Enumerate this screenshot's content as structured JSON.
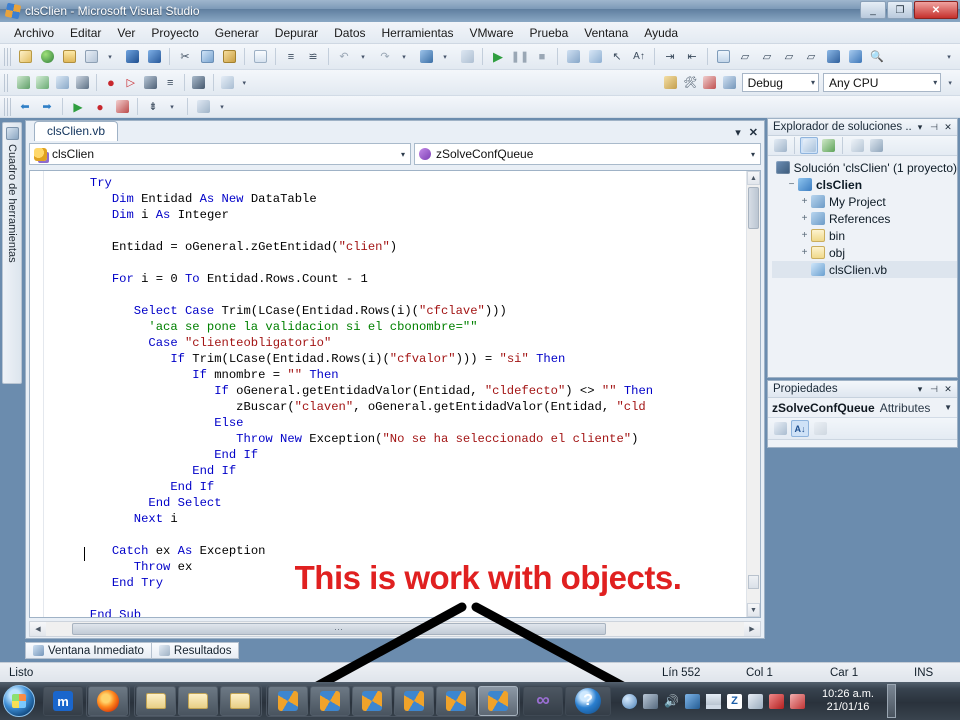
{
  "window": {
    "title": "clsClien - Microsoft Visual Studio",
    "icon": "visual-studio-icon",
    "minimize": "_",
    "maximize": "❐",
    "close": "✕"
  },
  "menubar": {
    "items": [
      "Archivo",
      "Editar",
      "Ver",
      "Proyecto",
      "Generar",
      "Depurar",
      "Datos",
      "Herramientas",
      "VMware",
      "Prueba",
      "Ventana",
      "Ayuda"
    ]
  },
  "toolbar": {
    "configuration": "Debug",
    "platform": "Any CPU",
    "overflow_label": "▾"
  },
  "left_dock": {
    "toolbox_label": "Cuadro de herramientas",
    "toolbox_icon": "toolbox-icon"
  },
  "editor": {
    "tab_label": "clsClien.vb",
    "tab_menu_icon": "▾",
    "tab_close_icon": "✕",
    "class_combo": "clsClien",
    "member_combo": "zSolveConfQueue",
    "dropdown_arrow": "▼",
    "code_lines": [
      {
        "indent": 6,
        "spans": [
          {
            "t": "Try",
            "c": "kw"
          }
        ]
      },
      {
        "indent": 9,
        "spans": [
          {
            "t": "Dim ",
            "c": "kw"
          },
          {
            "t": "Entidad ",
            "c": ""
          },
          {
            "t": "As New ",
            "c": "kw"
          },
          {
            "t": "DataTable",
            "c": ""
          }
        ]
      },
      {
        "indent": 9,
        "spans": [
          {
            "t": "Dim ",
            "c": "kw"
          },
          {
            "t": "i ",
            "c": ""
          },
          {
            "t": "As ",
            "c": "kw"
          },
          {
            "t": "Integer",
            "c": ""
          }
        ]
      },
      {
        "indent": 0,
        "spans": []
      },
      {
        "indent": 9,
        "spans": [
          {
            "t": "Entidad = oGeneral.zGetEntidad(",
            "c": ""
          },
          {
            "t": "\"clien\"",
            "c": "str"
          },
          {
            "t": ")",
            "c": ""
          }
        ]
      },
      {
        "indent": 0,
        "spans": []
      },
      {
        "indent": 9,
        "spans": [
          {
            "t": "For ",
            "c": "kw"
          },
          {
            "t": "i = 0 ",
            "c": ""
          },
          {
            "t": "To ",
            "c": "kw"
          },
          {
            "t": "Entidad.Rows.Count - 1",
            "c": ""
          }
        ]
      },
      {
        "indent": 0,
        "spans": []
      },
      {
        "indent": 12,
        "spans": [
          {
            "t": "Select Case ",
            "c": "kw"
          },
          {
            "t": "Trim(LCase(Entidad.Rows(i)(",
            "c": ""
          },
          {
            "t": "\"cfclave\"",
            "c": "str"
          },
          {
            "t": ")))",
            "c": ""
          }
        ]
      },
      {
        "indent": 14,
        "spans": [
          {
            "t": "'aca se pone la validacion si el cbonombre=\"\"",
            "c": "cmt"
          }
        ]
      },
      {
        "indent": 14,
        "spans": [
          {
            "t": "Case ",
            "c": "kw"
          },
          {
            "t": "\"clienteobligatorio\"",
            "c": "str"
          }
        ]
      },
      {
        "indent": 17,
        "spans": [
          {
            "t": "If ",
            "c": "kw"
          },
          {
            "t": "Trim(LCase(Entidad.Rows(i)(",
            "c": ""
          },
          {
            "t": "\"cfvalor\"",
            "c": "str"
          },
          {
            "t": "))) = ",
            "c": ""
          },
          {
            "t": "\"si\" ",
            "c": "str"
          },
          {
            "t": "Then",
            "c": "kw"
          }
        ]
      },
      {
        "indent": 20,
        "spans": [
          {
            "t": "If ",
            "c": "kw"
          },
          {
            "t": "mnombre = ",
            "c": ""
          },
          {
            "t": "\"\" ",
            "c": "str"
          },
          {
            "t": "Then",
            "c": "kw"
          }
        ]
      },
      {
        "indent": 23,
        "spans": [
          {
            "t": "If ",
            "c": "kw"
          },
          {
            "t": "oGeneral.getEntidadValor(Entidad, ",
            "c": ""
          },
          {
            "t": "\"cldefecto\"",
            "c": "str"
          },
          {
            "t": ") <> ",
            "c": ""
          },
          {
            "t": "\"\" ",
            "c": "str"
          },
          {
            "t": "Then",
            "c": "kw"
          }
        ]
      },
      {
        "indent": 26,
        "spans": [
          {
            "t": "zBuscar(",
            "c": ""
          },
          {
            "t": "\"claven\"",
            "c": "str"
          },
          {
            "t": ", oGeneral.getEntidadValor(Entidad, ",
            "c": ""
          },
          {
            "t": "\"cld",
            "c": "str"
          }
        ]
      },
      {
        "indent": 23,
        "spans": [
          {
            "t": "Else",
            "c": "kw"
          }
        ]
      },
      {
        "indent": 26,
        "spans": [
          {
            "t": "Throw New ",
            "c": "kw"
          },
          {
            "t": "Exception(",
            "c": ""
          },
          {
            "t": "\"No se ha seleccionado el cliente\"",
            "c": "str"
          },
          {
            "t": ")",
            "c": ""
          }
        ]
      },
      {
        "indent": 23,
        "spans": [
          {
            "t": "End If",
            "c": "kw"
          }
        ]
      },
      {
        "indent": 20,
        "spans": [
          {
            "t": "End If",
            "c": "kw"
          }
        ]
      },
      {
        "indent": 17,
        "spans": [
          {
            "t": "End If",
            "c": "kw"
          }
        ]
      },
      {
        "indent": 14,
        "spans": [
          {
            "t": "End Select",
            "c": "kw"
          }
        ]
      },
      {
        "indent": 12,
        "spans": [
          {
            "t": "Next ",
            "c": "kw"
          },
          {
            "t": "i",
            "c": ""
          }
        ]
      },
      {
        "indent": 0,
        "spans": []
      },
      {
        "indent": 9,
        "spans": [
          {
            "t": "Catch ",
            "c": "kw"
          },
          {
            "t": "ex ",
            "c": ""
          },
          {
            "t": "As ",
            "c": "kw"
          },
          {
            "t": "Exception",
            "c": ""
          }
        ]
      },
      {
        "indent": 12,
        "spans": [
          {
            "t": "Throw ",
            "c": "kw"
          },
          {
            "t": "ex",
            "c": ""
          }
        ]
      },
      {
        "indent": 9,
        "spans": [
          {
            "t": "End Try",
            "c": "kw"
          }
        ]
      },
      {
        "indent": 0,
        "spans": []
      },
      {
        "indent": 6,
        "spans": [
          {
            "t": "End Sub",
            "c": "kw"
          }
        ]
      }
    ]
  },
  "annotation": {
    "text": "This is work with objects.",
    "color": "#e02020"
  },
  "solution_explorer": {
    "title": "Explorador de soluciones ...",
    "dropdown_icon": "▾",
    "pin_icon": "⊣",
    "close_icon": "✕",
    "tools": [
      "properties-icon",
      "show-all-files-icon",
      "refresh-icon",
      "view-code-icon",
      "view-designer-icon"
    ],
    "tree": [
      {
        "label": "Solución 'clsClien'  (1 proyecto)",
        "depth": 0,
        "expander": "",
        "icon": "solution-icon",
        "bold": false,
        "selected": false
      },
      {
        "label": "clsClien",
        "depth": 1,
        "expander": "−",
        "icon": "project-icon",
        "bold": true,
        "selected": false
      },
      {
        "label": "My Project",
        "depth": 2,
        "expander": "+",
        "icon": "my-project-icon",
        "bold": false,
        "selected": false
      },
      {
        "label": "References",
        "depth": 2,
        "expander": "+",
        "icon": "references-icon",
        "bold": false,
        "selected": false
      },
      {
        "label": "bin",
        "depth": 2,
        "expander": "+",
        "icon": "folder-icon",
        "bold": false,
        "selected": false
      },
      {
        "label": "obj",
        "depth": 2,
        "expander": "+",
        "icon": "folder-icon",
        "bold": false,
        "selected": false
      },
      {
        "label": "clsClien.vb",
        "depth": 2,
        "expander": "",
        "icon": "vb-file-icon",
        "bold": false,
        "selected": true
      }
    ]
  },
  "properties": {
    "title": "Propiedades",
    "dropdown_icon": "▾",
    "pin_icon": "⊣",
    "close_icon": "✕",
    "selected_object": "zSolveConfQueue",
    "selected_kind": "Attributes",
    "dropdown_arrow": "▼",
    "tools": [
      "categorized-icon",
      "alphabetical-icon",
      "property-pages-icon"
    ]
  },
  "bottom_tabs": [
    {
      "label": "Ventana Inmediato",
      "icon": "immediate-window-icon"
    },
    {
      "label": "Resultados",
      "icon": "output-window-icon"
    }
  ],
  "statusbar": {
    "state": "Listo",
    "line": "Lín 552",
    "column": "Col 1",
    "character": "Car 1",
    "insert_mode": "INS"
  },
  "taskbar": {
    "start_label": "start-orb",
    "items": [
      {
        "name": "maxthon",
        "icon": "maxthon-icon",
        "glyph": "m",
        "active": false
      },
      {
        "name": "firefox",
        "icon": "firefox-icon",
        "glyph": "",
        "active": false
      },
      {
        "name": "explorer-window-1",
        "icon": "folder-icon",
        "glyph": "",
        "active": false
      },
      {
        "name": "explorer-window-2",
        "icon": "folder-icon",
        "glyph": "",
        "active": false
      },
      {
        "name": "explorer-window-3",
        "icon": "folder-icon",
        "glyph": "",
        "active": false
      },
      {
        "name": "visual-studio-1",
        "icon": "visual-studio-icon",
        "glyph": "",
        "active": false
      },
      {
        "name": "visual-studio-2",
        "icon": "visual-studio-icon",
        "glyph": "",
        "active": false
      },
      {
        "name": "visual-studio-3",
        "icon": "visual-studio-icon",
        "glyph": "",
        "active": false
      },
      {
        "name": "visual-studio-4",
        "icon": "visual-studio-icon",
        "glyph": "",
        "active": false
      },
      {
        "name": "visual-studio-5",
        "icon": "visual-studio-icon",
        "glyph": "",
        "active": false
      },
      {
        "name": "visual-studio-6",
        "icon": "visual-studio-icon",
        "glyph": "",
        "active": true
      },
      {
        "name": "camtasia",
        "icon": "infinity-icon",
        "glyph": "∞",
        "active": false
      },
      {
        "name": "help-window",
        "icon": "help-icon",
        "glyph": "?",
        "active": false
      }
    ],
    "tray": [
      "action-center-icon",
      "network-flyout-icon",
      "volume-icon",
      "share-icon",
      "signal-icon",
      "zoom-icon",
      "monitor-icon",
      "antivirus-icon",
      "printer-icon"
    ],
    "clock_time": "10:26 a.m.",
    "clock_date": "21/01/16"
  }
}
